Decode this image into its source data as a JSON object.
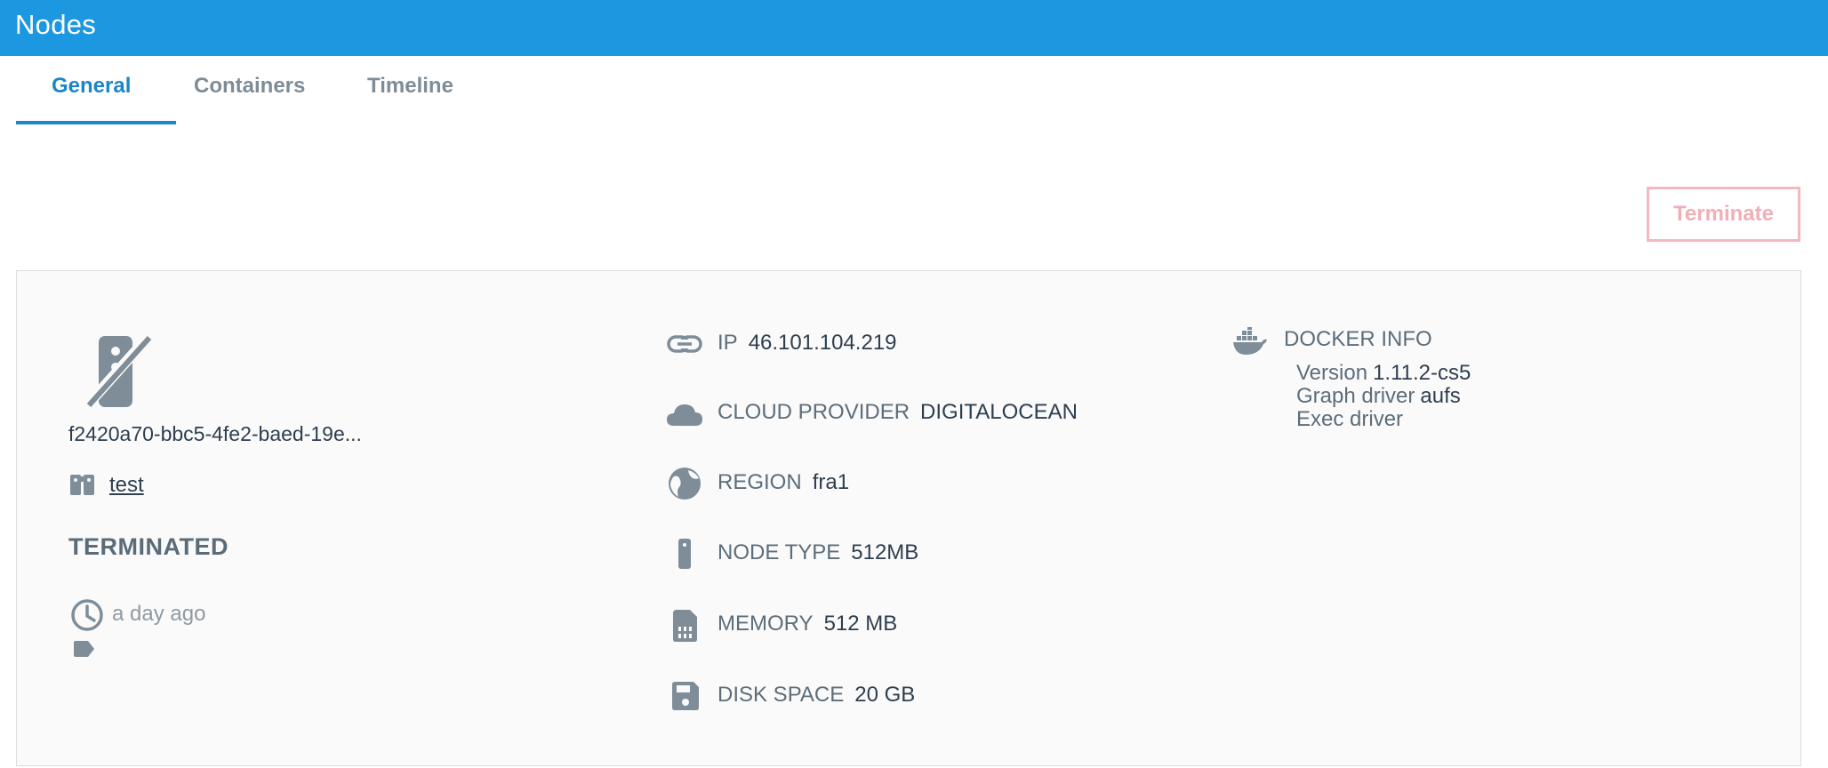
{
  "header": {
    "title": "Nodes"
  },
  "tabs": [
    {
      "label": "General",
      "active": true
    },
    {
      "label": "Containers",
      "active": false
    },
    {
      "label": "Timeline",
      "active": false
    }
  ],
  "actions": {
    "terminate_label": "Terminate"
  },
  "node": {
    "name": "f2420a70-bbc5-4fe2-baed-19e...",
    "cluster": "test",
    "status": "TERMINATED",
    "time_ago": "a day ago"
  },
  "info": {
    "ip": {
      "label": "IP",
      "value": "46.101.104.219",
      "icon": "link-icon"
    },
    "cloud_provider": {
      "label": "CLOUD PROVIDER",
      "value": "DIGITALOCEAN",
      "icon": "cloud-icon"
    },
    "region": {
      "label": "REGION",
      "value": "fra1",
      "icon": "globe-icon"
    },
    "node_type": {
      "label": "NODE TYPE",
      "value": "512MB",
      "icon": "server-icon"
    },
    "memory": {
      "label": "MEMORY",
      "value": "512 MB",
      "icon": "memory-icon"
    },
    "disk_space": {
      "label": "DISK SPACE",
      "value": "20 GB",
      "icon": "floppy-icon"
    }
  },
  "docker": {
    "heading": "DOCKER INFO",
    "version_label": "Version",
    "version_value": "1.11.2-cs5",
    "graph_driver_label": "Graph driver",
    "graph_driver_value": "aufs",
    "exec_driver_label": "Exec driver",
    "exec_driver_value": ""
  },
  "colors": {
    "topbar": "#1b98e0",
    "accent": "#1b86c9",
    "danger": "#f2aeb5",
    "icon": "#7f8d98"
  }
}
